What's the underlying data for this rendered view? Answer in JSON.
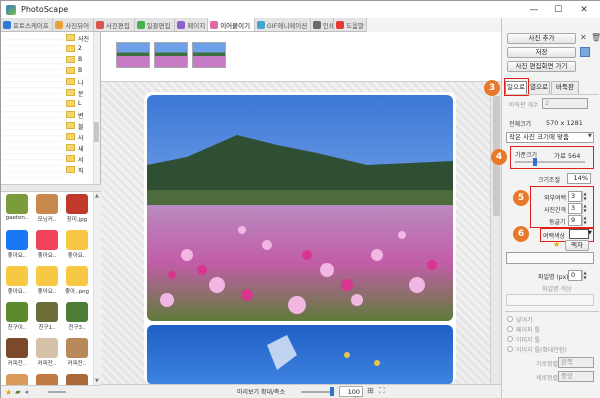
{
  "titlebar": {
    "title": "PhotoScape",
    "minimize": "—",
    "maximize": "☐",
    "close": "✕"
  },
  "tabs": [
    {
      "label": "포토스케이프",
      "color": "#2e7bd6"
    },
    {
      "label": "사진뷰어",
      "color": "#e7a23a"
    },
    {
      "label": "사진편집",
      "color": "#d9534f"
    },
    {
      "label": "일괄편집",
      "color": "#4caf50"
    },
    {
      "label": "페이지",
      "color": "#8e63c9"
    },
    {
      "label": "이어붙이기",
      "color": "#e06aa6"
    },
    {
      "label": "GIF애니메이션",
      "color": "#43a5d1"
    },
    {
      "label": "인쇄",
      "color": "#6b6b6b"
    },
    {
      "label": "도움말",
      "color": "#e53935"
    }
  ],
  "tree": {
    "labels": [
      "사진",
      "2",
      "B",
      "B",
      "나",
      "문",
      "L",
      "변",
      "블",
      "사",
      "새",
      "서",
      "직"
    ]
  },
  "files": [
    {
      "caption": "gaeton..",
      "color": "#7a9c3b"
    },
    {
      "caption": "모닝커..",
      "color": "#c8894c"
    },
    {
      "caption": "장미.jpg",
      "color": "#c0392b"
    },
    {
      "caption": "좋아요..",
      "color": "#1877f2"
    },
    {
      "caption": "좋아요..",
      "color": "#f0425a"
    },
    {
      "caption": "좋아요..",
      "color": "#f7c843"
    },
    {
      "caption": "좋아요..",
      "color": "#f7c843"
    },
    {
      "caption": "좋아요..",
      "color": "#f7c843"
    },
    {
      "caption": "좋아..png",
      "color": "#f7c843"
    },
    {
      "caption": "친구이..",
      "color": "#5c8a2e"
    },
    {
      "caption": "친구1..",
      "color": "#6d6d3a"
    },
    {
      "caption": "친구3..",
      "color": "#4b7d35"
    },
    {
      "caption": "커피잔..",
      "color": "#7b4a2b"
    },
    {
      "caption": "커피잔..",
      "color": "#d6c2a8"
    },
    {
      "caption": "커피잔..",
      "color": "#b88a5a"
    },
    {
      "caption": "",
      "color": "#d99a5b"
    },
    {
      "caption": "",
      "color": "#c27a45"
    },
    {
      "caption": "",
      "color": "#a86a3a"
    }
  ],
  "statusbar": {
    "zoom_label": "미리보기 확대/축소",
    "zoom_value": "100 %",
    "zoom_slider_level": 0.9
  },
  "right": {
    "add_photo": "사진 추가",
    "save": "저장",
    "send_to_editor": "사진 편집화면 가기",
    "tabs": [
      "일으로",
      "열으로",
      "바둑판"
    ],
    "col_count_label": "바둑판 개수",
    "col_count_value": "2",
    "full_size_label": "전체크기",
    "full_size_value": "570 x 1281",
    "fit_option": "작은 사진 크기에 맞춤",
    "base_size_label": "기준크기",
    "base_size_value": "가로 564",
    "base_size_slider_level": 0.25,
    "scale_label": "크기조절",
    "scale_value": "14%",
    "outer_margin_label": "외부여백",
    "outer_margin_value": "3",
    "spacing_label": "사진간격",
    "spacing_value": "3",
    "round_label": "둥글기",
    "round_value": "9",
    "margin_color_label": "여백색상",
    "frame_button": "액자",
    "file_size_label": "파일명 (px)",
    "file_size_value": "0",
    "file_color_label": "파일명 색상",
    "radio_none": "넣어기",
    "radio_frame": "페이퍼 틀",
    "radio_image": "이미지 틀",
    "radio_image_tile": "이미지 틀(확대안함)",
    "halign_label": "가로정렬",
    "halign_value": "왼쪽",
    "valign_label": "세로정렬",
    "valign_value": "중앙"
  },
  "annotations": [
    {
      "number": "3",
      "color": "#e8782a"
    },
    {
      "number": "4",
      "color": "#e8782a"
    },
    {
      "number": "5",
      "color": "#e8782a"
    },
    {
      "number": "6",
      "color": "#e8782a"
    }
  ]
}
